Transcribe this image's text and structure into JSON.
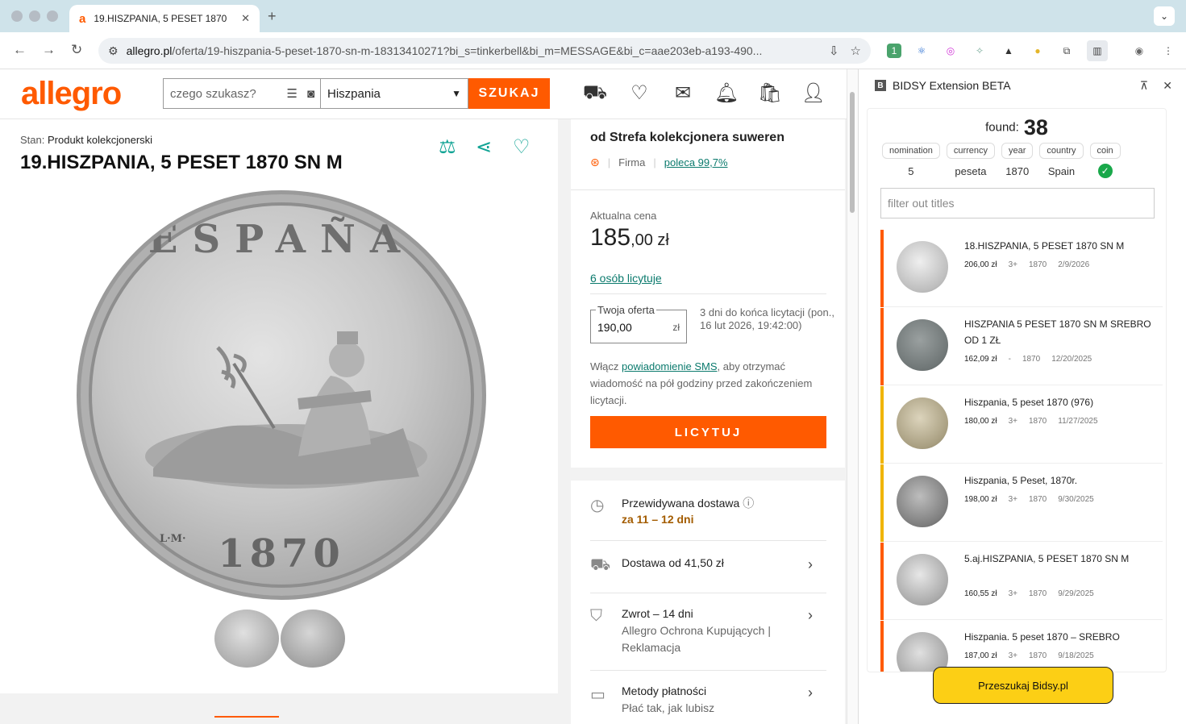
{
  "browser": {
    "tab_title": "19.HISZPANIA, 5 PESET 1870",
    "tab_favicon": "a",
    "url_host": "allegro.pl",
    "url_path": "/oferta/19-hiszpania-5-peset-1870-sn-m-18313410271?bi_s=tinkerbell&bi_m=MESSAGE&bi_c=aae203eb-a193-490...",
    "ext_badge": "1"
  },
  "header": {
    "logo": "allegro",
    "search_placeholder": "czego szukasz?",
    "category_value": "Hiszpania",
    "search_button": "SZUKAJ"
  },
  "product": {
    "state_label": "Stan:",
    "state_value": "Produkt kolekcjonerski",
    "title": "19.HISZPANIA, 5 PESET 1870 SN M",
    "coin_legend": "ESPAÑA",
    "coin_mark": "L·M·",
    "coin_year": "1870"
  },
  "offer": {
    "seller": "od Strefa kolekcjonera suweren",
    "seller_type": "Firma",
    "seller_rec": "poleca 99,7%",
    "price_label": "Aktualna cena",
    "price_int": "185",
    "price_dec": ",00 zł",
    "bidders": "6 osób licytuje",
    "bid_label": "Twoja oferta",
    "bid_value": "190,00",
    "bid_currency": "zł",
    "time_left": "3 dni do końca licytacji (pon., 16 lut 2026, 19:42:00)",
    "sms_pre": "Włącz ",
    "sms_link": "powiadomienie SMS",
    "sms_post": ", aby otrzymać wiadomość na pół godziny przed zakończeniem licytacji.",
    "bid_button": "LICYTUJ"
  },
  "delivery": {
    "expected_label": "Przewidywana dostawa",
    "expected_value": "za 11 – 12 dni",
    "shipping": "Dostawa od 41,50 zł",
    "returns": "Zwrot – 14 dni",
    "returns_sub": "Allegro Ochrona Kupujących | Reklamacja",
    "payment": "Metody płatności",
    "payment_sub": "Płać tak, jak lubisz"
  },
  "bidsy": {
    "title": "BIDSY Extension BETA",
    "found_label": "found:",
    "found_count": "38",
    "filters": [
      {
        "label": "nomination",
        "value": "5"
      },
      {
        "label": "currency",
        "value": "peseta"
      },
      {
        "label": "year",
        "value": "1870"
      },
      {
        "label": "country",
        "value": "Spain"
      },
      {
        "label": "coin",
        "value": ""
      }
    ],
    "filter_placeholder": "filter out titles",
    "results": [
      {
        "title": "18.HISZPANIA, 5 PESET 1870 SN M",
        "price": "206,00 zł",
        "bids": "3+",
        "year": "1870",
        "date": "2/9/2026",
        "bar": "#ff5a00"
      },
      {
        "title": "HISZPANIA 5 PESET 1870 SN M SREBRO OD 1 ZŁ",
        "price": "162,09 zł",
        "bids": "-",
        "year": "1870",
        "date": "12/20/2025",
        "bar": "#ff5a00"
      },
      {
        "title": "Hiszpania, 5 peset 1870 (976)",
        "price": "180,00 zł",
        "bids": "3+",
        "year": "1870",
        "date": "11/27/2025",
        "bar": "#f0b400"
      },
      {
        "title": "Hiszpania, 5 Peset, 1870r.",
        "price": "198,00 zł",
        "bids": "3+",
        "year": "1870",
        "date": "9/30/2025",
        "bar": "#f0b400"
      },
      {
        "title": "5.aj.HISZPANIA, 5 PESET 1870 SN M",
        "price": "160,55 zł",
        "bids": "3+",
        "year": "1870",
        "date": "9/29/2025",
        "bar": "#ff5a00"
      },
      {
        "title": "Hiszpania. 5 peset 1870 – SREBRO",
        "price": "187,00 zł",
        "bids": "3+",
        "year": "1870",
        "date": "9/18/2025",
        "bar": "#ff5a00"
      }
    ],
    "button": "Przeszukaj Bidsy.pl"
  }
}
